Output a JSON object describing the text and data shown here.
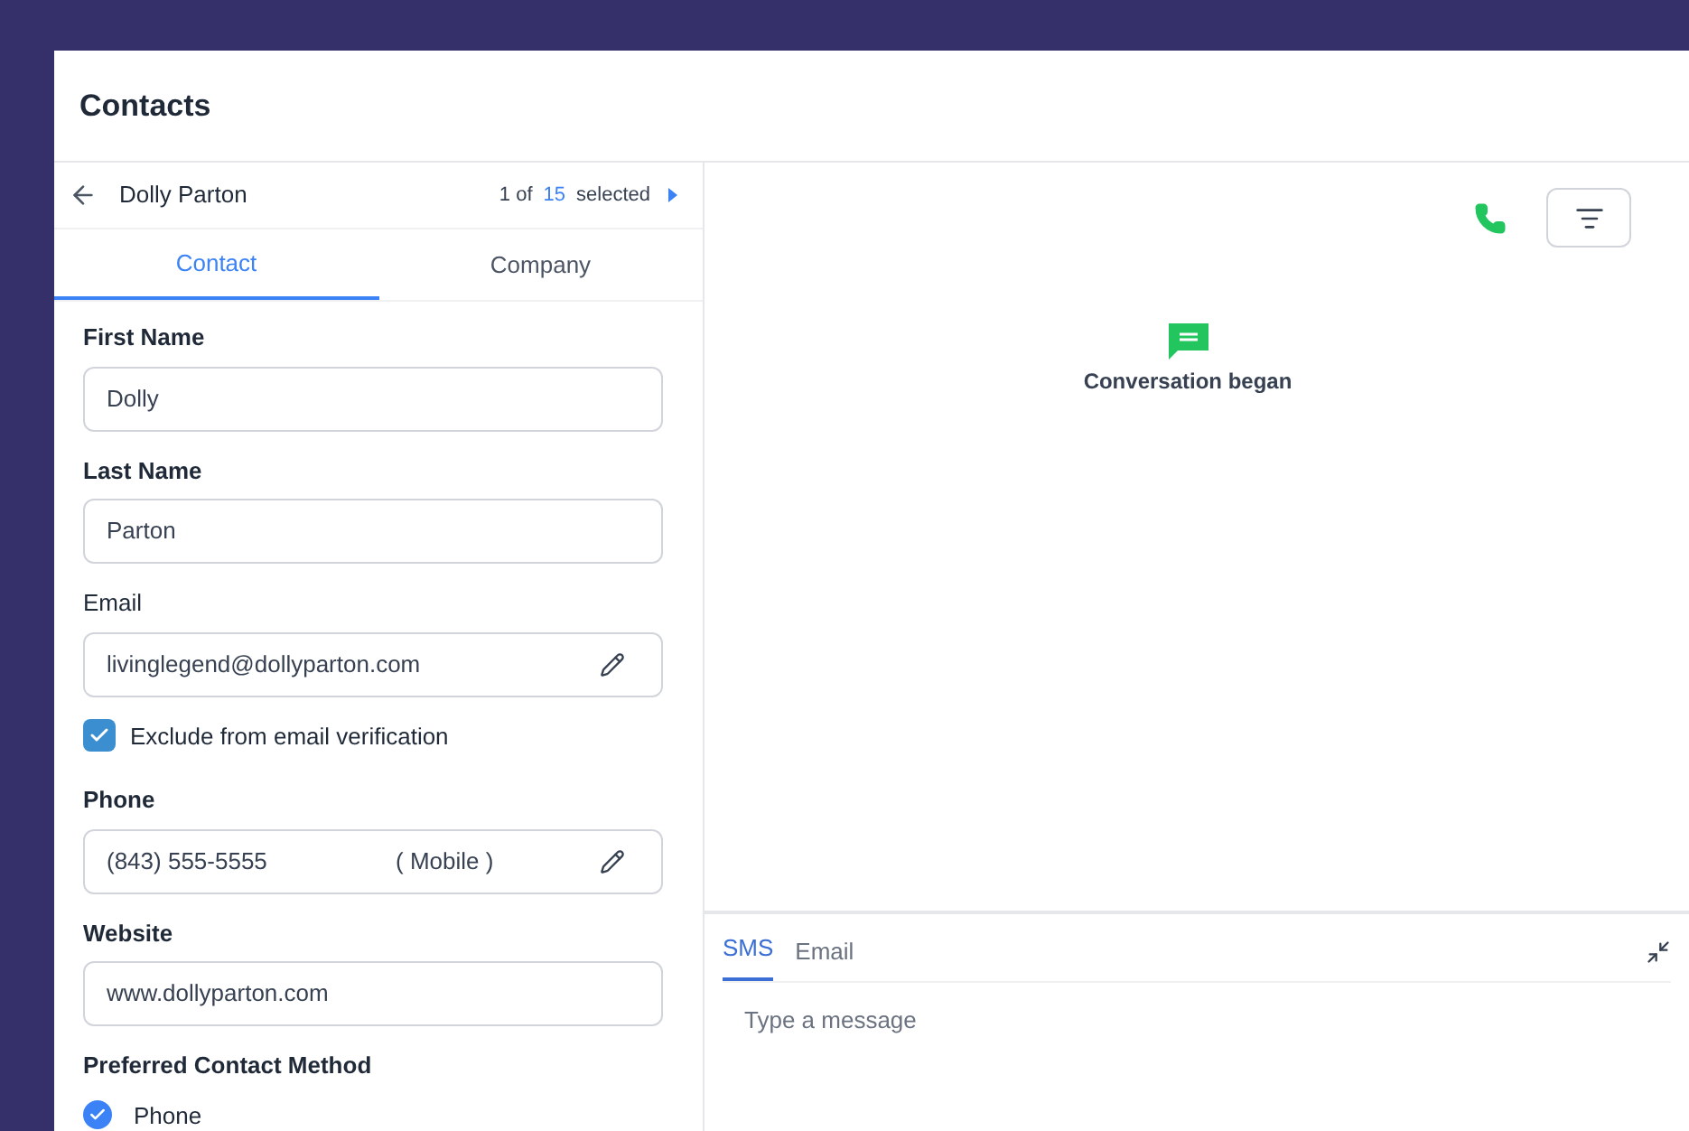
{
  "header": {
    "title": "Contacts"
  },
  "record_bar": {
    "name": "Dolly Parton",
    "position": "1 of",
    "total": "15",
    "suffix": "selected"
  },
  "tabs": [
    {
      "label": "Contact",
      "selected": true
    },
    {
      "label": "Company",
      "selected": false
    }
  ],
  "fields": [
    {
      "kind": "text",
      "label": "First Name",
      "value": "Dolly",
      "bold": true
    },
    {
      "kind": "text",
      "label": "Last Name",
      "value": "Parton",
      "bold": true
    },
    {
      "kind": "editable",
      "label": "Email",
      "value": "livinglegend@dollyparton.com",
      "bold": false
    },
    {
      "kind": "checkbox",
      "label": "Exclude from email verification",
      "checked": true
    },
    {
      "kind": "phone",
      "label": "Phone",
      "value": "(843) 555-5555",
      "type": "( Mobile )",
      "bold": true
    },
    {
      "kind": "text",
      "label": "Website",
      "value": "www.dollyparton.com",
      "bold": true
    },
    {
      "kind": "radio",
      "label": "Preferred Contact Method",
      "options": [
        {
          "label": "Phone",
          "selected": true
        }
      ]
    }
  ],
  "conversation": {
    "event": "Conversation began"
  },
  "composer": {
    "tabs": [
      {
        "label": "SMS",
        "selected": true
      },
      {
        "label": "Email",
        "selected": false
      }
    ],
    "placeholder": "Type a message"
  }
}
